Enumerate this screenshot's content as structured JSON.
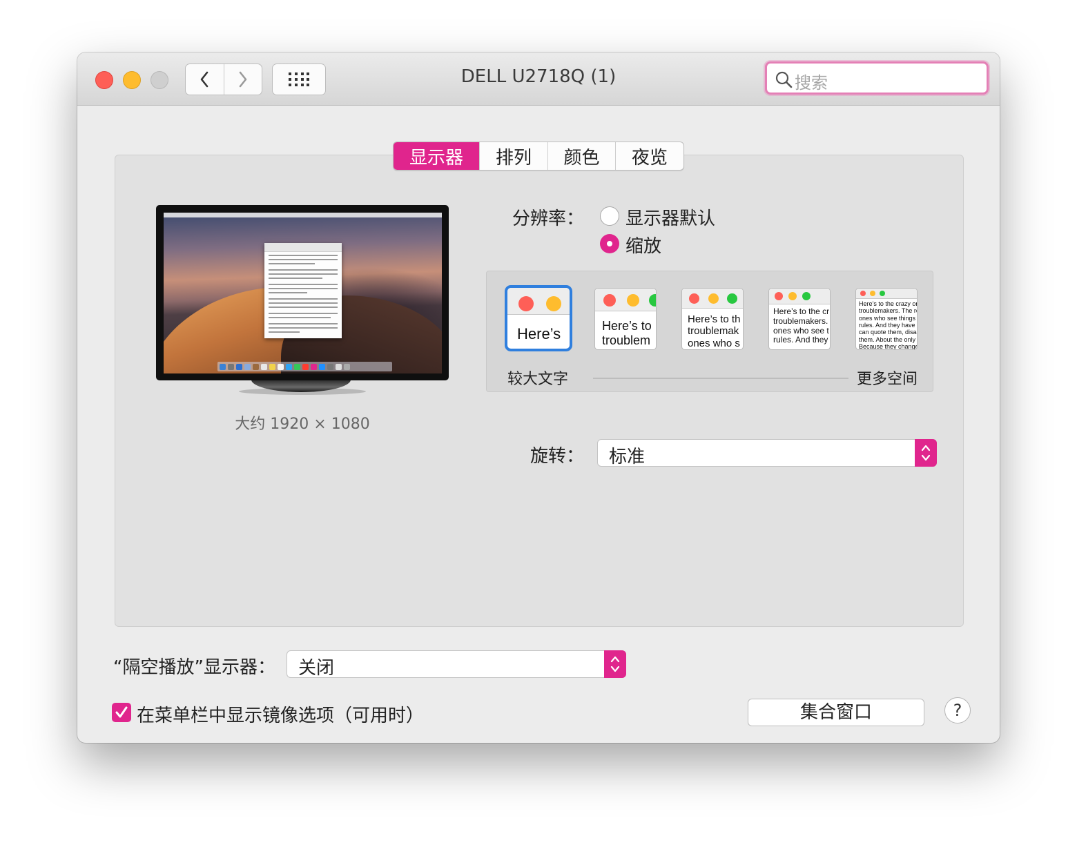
{
  "window": {
    "title": "DELL U2718Q (1)"
  },
  "toolbar": {
    "back_icon": "chevron-left-icon",
    "forward_icon": "chevron-right-icon",
    "show_all_icon": "grid-icon",
    "search_placeholder": "搜索"
  },
  "tabs": [
    {
      "label": "显示器",
      "active": true
    },
    {
      "label": "排列",
      "active": false
    },
    {
      "label": "颜色",
      "active": false
    },
    {
      "label": "夜览",
      "active": false
    }
  ],
  "display": {
    "resolution_caption": "大约 1920 × 1080",
    "resolution_label": "分辨率：",
    "options": [
      {
        "label": "显示器默认",
        "selected": false
      },
      {
        "label": "缩放",
        "selected": true
      }
    ],
    "scale_thumbnails": [
      {
        "text": "Here’s",
        "selected": true
      },
      {
        "text": "Here’s to\ntroublem",
        "selected": false
      },
      {
        "text": "Here’s to th\ntroublemak\nones who s",
        "selected": false
      },
      {
        "text": "Here’s to the cr\ntroublemakers.\nones who see t\nrules. And they",
        "selected": false
      },
      {
        "text": "Here’s to the crazy one\ntroublemakers. The rou\nones who see things dif\nrules. And they have no\ncan quote them, disagre\nthem. About the only th\nBecause they change th",
        "selected": false
      }
    ],
    "scale_left_label": "较大文字",
    "scale_right_label": "更多空间",
    "rotation_label": "旋转：",
    "rotation_value": "标准"
  },
  "airplay": {
    "label": "“隔空播放”显示器：",
    "value": "关闭"
  },
  "footer": {
    "mirror_checkbox_label": "在菜单栏中显示镜像选项（可用时）",
    "mirror_checked": true,
    "gather_button": "集合窗口",
    "help": "?"
  },
  "colors": {
    "accent": "#e0258d",
    "selection_blue": "#2f7fde"
  }
}
